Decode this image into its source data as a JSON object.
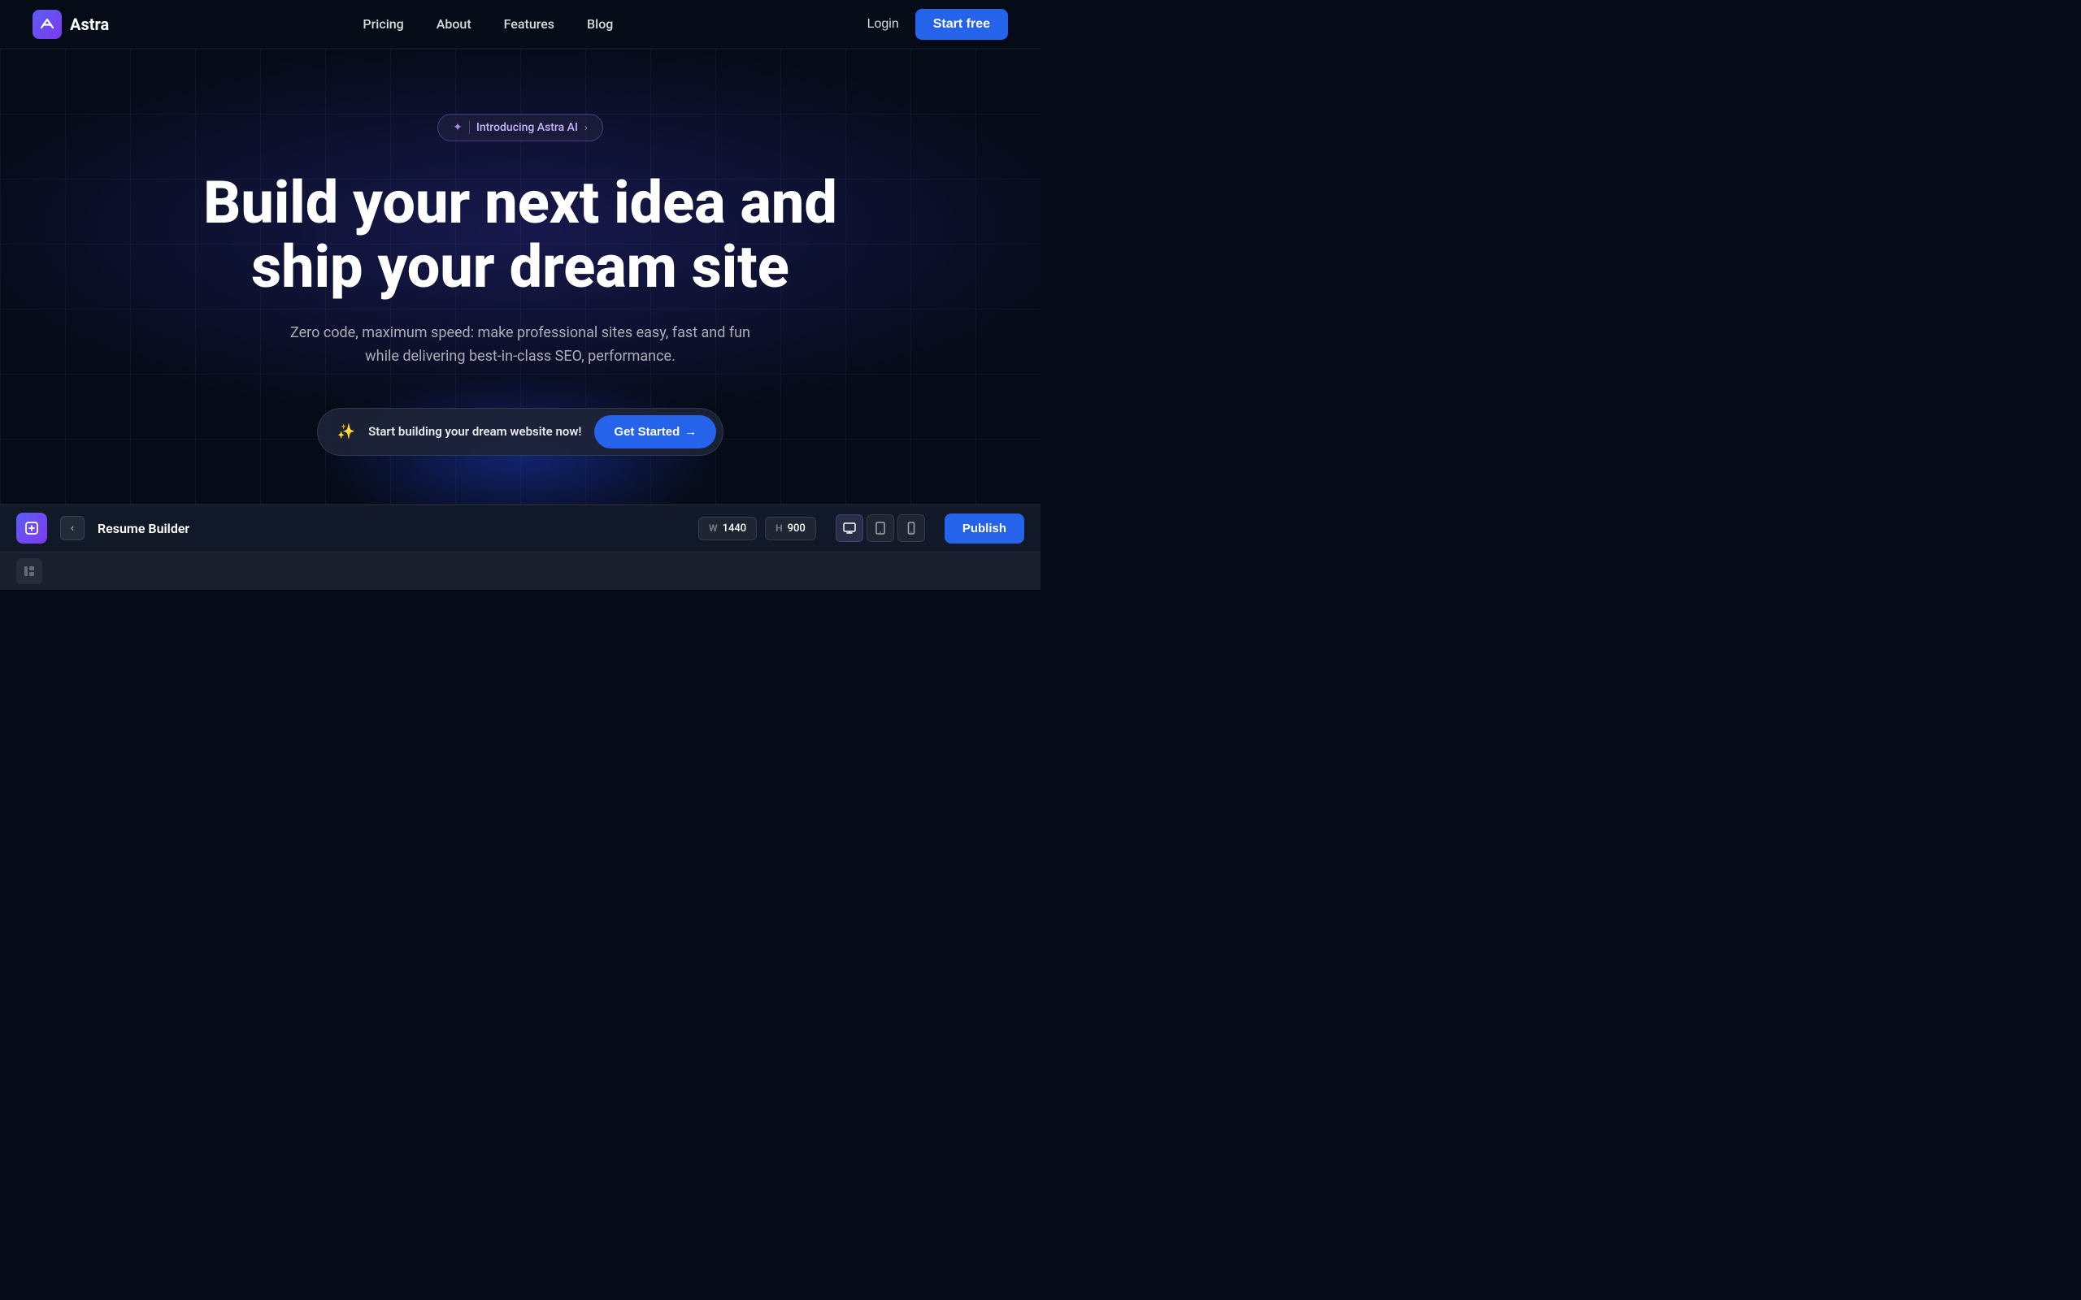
{
  "brand": {
    "logo_icon": "≋",
    "name": "Astra"
  },
  "nav": {
    "links": [
      {
        "label": "Pricing",
        "id": "pricing"
      },
      {
        "label": "About",
        "id": "about"
      },
      {
        "label": "Features",
        "id": "features"
      },
      {
        "label": "Blog",
        "id": "blog"
      }
    ],
    "login_label": "Login",
    "start_free_label": "Start free"
  },
  "hero": {
    "badge_icon": "✦",
    "badge_text": "Introducing Astra AI",
    "badge_chevron": "›",
    "title_line1": "Build your next idea and",
    "title_line2": "ship your dream site",
    "subtitle": "Zero code, maximum speed: make professional sites easy, fast and fun while delivering best-in-class SEO, performance.",
    "cta_icon": "✦",
    "cta_text": "Start building your dream website now!",
    "cta_button_label": "Get Started",
    "cta_button_arrow": "→"
  },
  "builder": {
    "app_icon": "{ }",
    "back_icon": "‹",
    "title": "Resume Builder",
    "width_label": "W",
    "width_value": "1440",
    "height_label": "H",
    "height_value": "900",
    "device_desktop_icon": "🖥",
    "device_tablet_icon": "📱",
    "device_mobile_icon": "▬",
    "publish_label": "Publish",
    "sidebar_icon": "⊞"
  },
  "colors": {
    "accent_blue": "#2563eb",
    "accent_purple": "#7c3aed",
    "bg_dark": "#060b18",
    "bg_panel": "#111827"
  }
}
